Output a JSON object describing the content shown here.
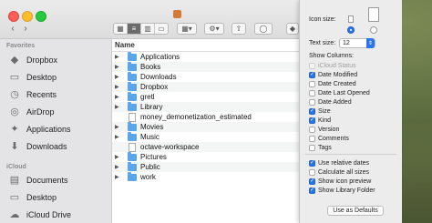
{
  "window": {
    "title": ""
  },
  "sidebar": {
    "favorites_header": "Favorites",
    "icloud_header": "iCloud",
    "favorites": [
      {
        "label": "Dropbox",
        "icon": "dropbox-icon"
      },
      {
        "label": "Desktop",
        "icon": "desktop-icon"
      },
      {
        "label": "Recents",
        "icon": "clock-icon"
      },
      {
        "label": "AirDrop",
        "icon": "airdrop-icon"
      },
      {
        "label": "Applications",
        "icon": "applications-icon"
      },
      {
        "label": "Downloads",
        "icon": "downloads-icon"
      }
    ],
    "icloud": [
      {
        "label": "Documents",
        "icon": "documents-icon"
      },
      {
        "label": "Desktop",
        "icon": "desktop-icon"
      },
      {
        "label": "iCloud Drive",
        "icon": "cloud-icon"
      }
    ]
  },
  "list": {
    "column_name": "Name",
    "rows": [
      {
        "name": "Applications",
        "kind": "folder",
        "expandable": true
      },
      {
        "name": "Books",
        "kind": "folder",
        "expandable": true
      },
      {
        "name": "Downloads",
        "kind": "folder",
        "expandable": true
      },
      {
        "name": "Dropbox",
        "kind": "folder",
        "expandable": true
      },
      {
        "name": "gretl",
        "kind": "folder",
        "expandable": true
      },
      {
        "name": "Library",
        "kind": "folder",
        "expandable": true
      },
      {
        "name": "money_demonetization_estimated",
        "kind": "file",
        "expandable": false
      },
      {
        "name": "Movies",
        "kind": "folder",
        "expandable": true
      },
      {
        "name": "Music",
        "kind": "folder",
        "expandable": true
      },
      {
        "name": "octave-workspace",
        "kind": "file",
        "expandable": false
      },
      {
        "name": "Pictures",
        "kind": "folder",
        "expandable": true
      },
      {
        "name": "Public",
        "kind": "folder",
        "expandable": true
      },
      {
        "name": "work",
        "kind": "folder",
        "expandable": true
      }
    ]
  },
  "view_options": {
    "icon_size_label": "Icon size:",
    "text_size_label": "Text size:",
    "text_size_value": "12",
    "show_columns_label": "Show Columns:",
    "columns": [
      {
        "label": "iCloud Status",
        "checked": false,
        "disabled": true
      },
      {
        "label": "Date Modified",
        "checked": true,
        "disabled": false
      },
      {
        "label": "Date Created",
        "checked": false,
        "disabled": false
      },
      {
        "label": "Date Last Opened",
        "checked": false,
        "disabled": false
      },
      {
        "label": "Date Added",
        "checked": false,
        "disabled": false
      },
      {
        "label": "Size",
        "checked": true,
        "disabled": false
      },
      {
        "label": "Kind",
        "checked": true,
        "disabled": false
      },
      {
        "label": "Version",
        "checked": false,
        "disabled": false
      },
      {
        "label": "Comments",
        "checked": false,
        "disabled": false
      },
      {
        "label": "Tags",
        "checked": false,
        "disabled": false
      }
    ],
    "options": [
      {
        "label": "Use relative dates",
        "checked": true
      },
      {
        "label": "Calculate all sizes",
        "checked": false
      },
      {
        "label": "Show icon preview",
        "checked": true
      },
      {
        "label": "Show Library Folder",
        "checked": true
      }
    ],
    "defaults_button": "Use as Defaults"
  },
  "colors": {
    "accent": "#2a75e8",
    "folder": "#5aa6e8",
    "sidebar_bg": "#e4e4e6"
  }
}
